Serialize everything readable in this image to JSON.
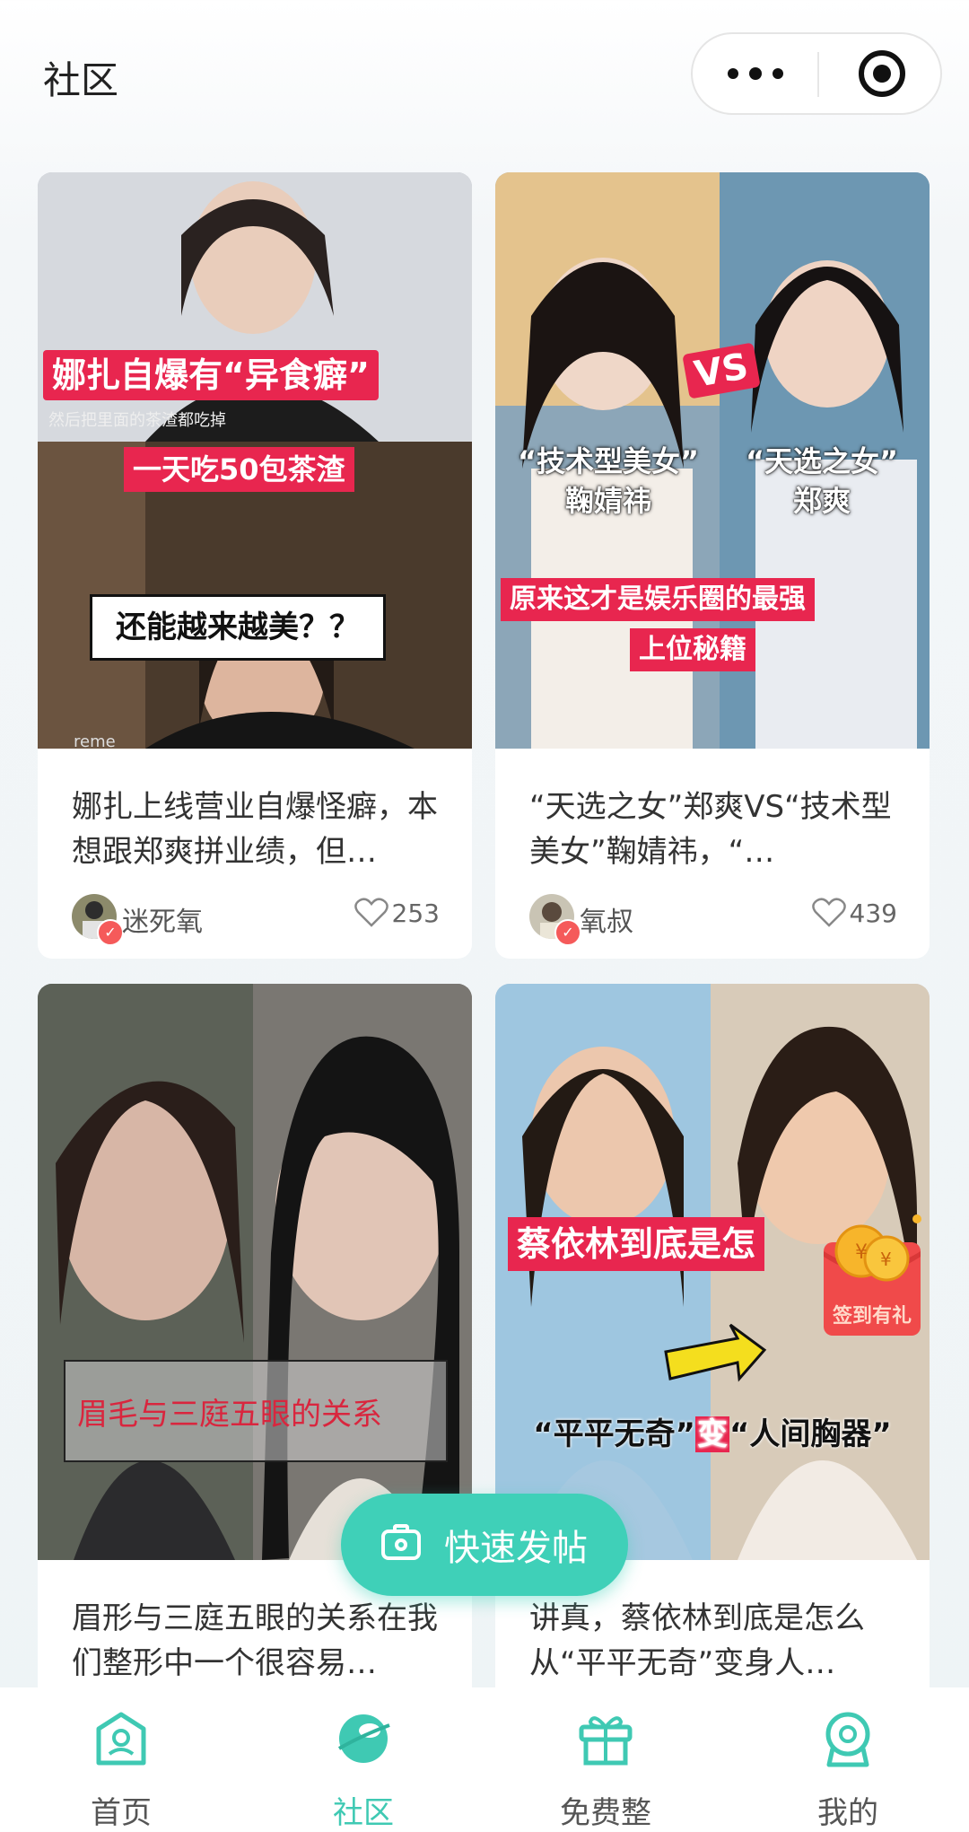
{
  "header": {
    "title": "社区"
  },
  "cards": [
    {
      "image_text": {
        "headline": "娜扎自爆有“异食癖”",
        "sub": "然后把里面的茶渣都吃掉",
        "band": "一天吃50包茶渣",
        "bubble": "还能越来越美？？",
        "brand": "reme"
      },
      "desc": "娜扎上线营业自爆怪癖，本想跟郑爽拼业绩，但…",
      "author": "迷死氧",
      "likes": "253"
    },
    {
      "image_text": {
        "vs": "VS",
        "left": "“技术型美女”\n鞠婧祎",
        "right": "“天选之女”\n郑爽",
        "band1": "原来这才是娱乐圈的最强",
        "band2": "上位秘籍"
      },
      "desc": "“天选之女”郑爽VS“技术型美女”鞠婧祎，“…",
      "author": "氧叔",
      "likes": "439"
    },
    {
      "image_text": {
        "caption": "眉毛与三庭五眼的关系"
      },
      "desc": "眉形与三庭五眼的关系在我们整形中一个很容易…"
    },
    {
      "image_text": {
        "headline": "蔡依林到底是怎",
        "left": "“平平无奇”",
        "mid": "变",
        "right": "“人间胸器”"
      },
      "desc": "讲真，蔡依林到底是怎么从“平平无奇”变身人…"
    }
  ],
  "fab": {
    "label": "快速发帖"
  },
  "envelope": {
    "label": "签到有礼"
  },
  "tabbar": {
    "items": [
      {
        "label": "首页"
      },
      {
        "label": "社区",
        "active": true
      },
      {
        "label": "免费整"
      },
      {
        "label": "我的"
      }
    ]
  },
  "colors": {
    "accent": "#3fc9b3",
    "red": "#e8264f"
  }
}
